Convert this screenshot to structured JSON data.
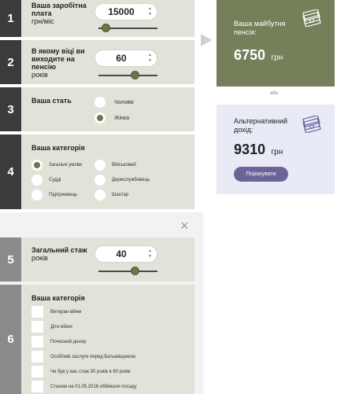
{
  "step1": {
    "number": "1",
    "label": "Ваша заробітна плата",
    "unit": "грн/міс",
    "value": "15000",
    "slider_fraction": 0.12
  },
  "step2": {
    "number": "2",
    "label": "В якому віці ви виходите на пенсію",
    "unit": "років",
    "value": "60",
    "slider_fraction": 0.62
  },
  "step3": {
    "number": "3",
    "label": "Ваша стать",
    "options": [
      "Чоловік",
      "Жінка"
    ],
    "selected": "Жінка"
  },
  "step4": {
    "number": "4",
    "label": "Ваша категорія",
    "options": [
      "Загальні умови",
      "Військовий",
      "Судді",
      "Держслужбовець",
      "Підприємець",
      "Шахтар"
    ],
    "selected": "Загальні умови"
  },
  "step5": {
    "number": "5",
    "label": "Загальний стаж",
    "unit": "років",
    "value": "40",
    "slider_fraction": 0.62
  },
  "step6": {
    "number": "6",
    "label": "Ваша категорія",
    "options": [
      "Ветеран війни",
      "Діти війни",
      "Почесний донор",
      "Особливі заслуги перед Батьківщиною",
      "Чи був у вас стаж 30 років в 60 років",
      "Станом на 01.05.2016 обіймали посаду"
    ]
  },
  "result_main": {
    "title": "Ваша майбутня пенсія:",
    "amount": "6750",
    "currency": "грн"
  },
  "or_text": "або",
  "result_alt": {
    "title": "Альтернативний дохід:",
    "amount": "9310",
    "currency": "грн",
    "button": "Порахувати"
  },
  "close_symbol": "×",
  "icons": {
    "money": "money-stack-icon",
    "arrow": "triangle-right-icon",
    "close": "close-icon"
  },
  "colors": {
    "card_bg": "#dfe3d8",
    "accent_green": "#757f59",
    "button_purple": "#6b6399",
    "alt_bg": "#e8eaf6"
  }
}
